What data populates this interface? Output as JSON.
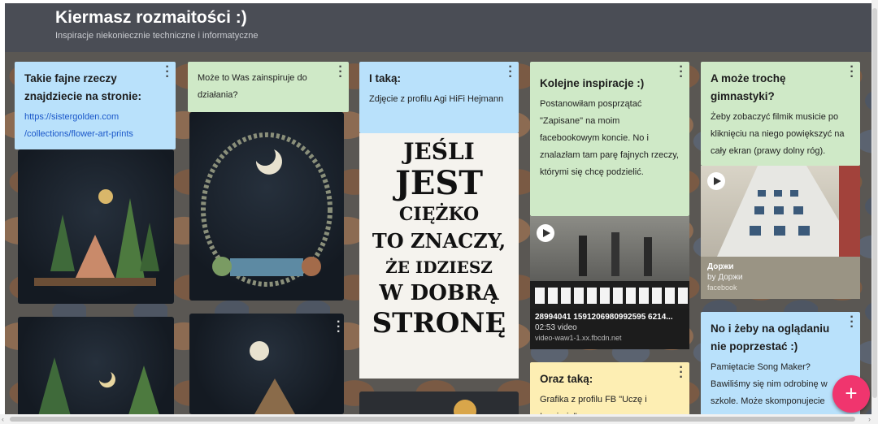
{
  "header": {
    "title": "Kiermasz rozmaitości :)",
    "subtitle": "Inspiracje niekoniecznie techniczne i informatyczne"
  },
  "cards": {
    "c1": {
      "title": "Takie fajne rzeczy znajdziecie na stronie:",
      "link": "https://sistergolden.com /collections/flower-art-prints"
    },
    "c2": {
      "body": "Może to Was zainspiruje do działania?"
    },
    "c3": {
      "title": "I taką:",
      "body": "Zdjęcie z profilu Agi HiFi Hejmann"
    },
    "c4": {
      "title": "Kolejne inspiracje :)",
      "body": "Postanowiłam posprzątać \"Zapisane\" na moim facebookowym koncie. No i znalazłam tam parę fajnych rzeczy, którymi się chcę podzielić.",
      "video_title": "28994041 1591206980992595 6214...",
      "video_meta": "02:53 video",
      "video_source": "video-waw1-1.xx.fbcdn.net"
    },
    "c5": {
      "title": "A może trochę gimnastyki?",
      "body": "Żeby zobaczyć filmik musicie po kliknięciu na niego powiększyć na cały ekran (prawy dolny róg).",
      "video_title": "Доржи",
      "video_author": "by Доржи",
      "video_source": "facebook"
    },
    "c6": {
      "title": "Oraz taką:",
      "body": "Grafika z profilu FB \"Uczę i Inspiruję\""
    },
    "c7": {
      "title": "No i żeby na oglądaniu nie poprzestać :)",
      "body": "Pamiętacie Song Maker? Bawiliśmy się nim odrobinę w szkole. Może skomponujecie własną muzykę? Jeśli uda Wam"
    }
  },
  "poster": {
    "lines": [
      "JEŚLI",
      "JEST",
      "CIĘŻKO",
      "TO ZNACZY,",
      "ŻE IDZIESZ",
      "W DOBRĄ",
      "STRONĘ"
    ]
  },
  "icons": {
    "more": "more-vert-icon",
    "add": "add-icon",
    "play": "play-icon"
  },
  "fab_label": "+",
  "colors": {
    "header": "#4a4d55",
    "card_blue": "#b9e1fb",
    "card_green": "#cfe9c7",
    "card_yellow": "#fdeeb3",
    "fab": "#f0356e"
  }
}
